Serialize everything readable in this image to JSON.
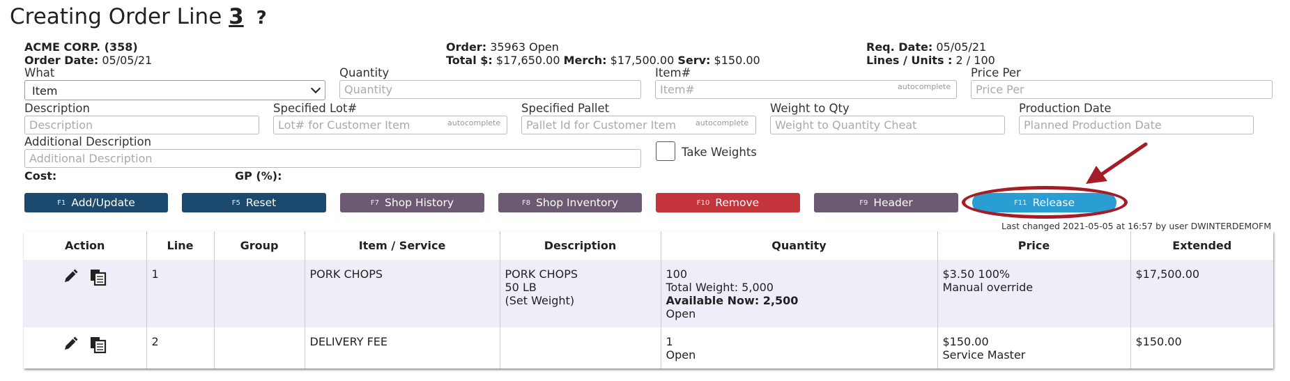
{
  "title": {
    "text": "Creating Order Line",
    "line_number": "3",
    "help": "?"
  },
  "header": {
    "customer": "ACME CORP. (358)",
    "order_date_label": "Order Date:",
    "order_date": "05/05/21",
    "order_label": "Order:",
    "order_value": "35963 Open",
    "total_label": "Total $:",
    "total_value": "$17,650.00",
    "merch_label": "Merch:",
    "merch_value": "$17,500.00",
    "serv_label": "Serv:",
    "serv_value": "$150.00",
    "req_date_label": "Req. Date:",
    "req_date": "05/05/21",
    "lines_units_label": "Lines / Units :",
    "lines_units": "2 / 100"
  },
  "form": {
    "what_label": "What",
    "what_value": "Item",
    "quantity_label": "Quantity",
    "quantity_placeholder": "Quantity",
    "item_label": "Item#",
    "item_placeholder": "Item#",
    "price_label": "Price Per",
    "price_placeholder": "Price Per",
    "description_label": "Description",
    "description_placeholder": "Description",
    "lot_label": "Specified Lot#",
    "lot_placeholder": "Lot# for Customer Item",
    "pallet_label": "Specified Pallet",
    "pallet_placeholder": "Pallet Id for Customer Item",
    "weight_label": "Weight to Qty",
    "weight_placeholder": "Weight to Quantity Cheat",
    "production_label": "Production Date",
    "production_placeholder": "Planned Production Date",
    "additional_label": "Additional Description",
    "additional_placeholder": "Additional Description",
    "take_weights_label": "Take Weights",
    "autocomplete_hint": "autocomplete",
    "cost_label": "Cost:",
    "gp_label": "GP (%):"
  },
  "buttons": [
    {
      "key": "F1",
      "label": "Add/Update"
    },
    {
      "key": "F5",
      "label": "Reset"
    },
    {
      "key": "F7",
      "label": "Shop History"
    },
    {
      "key": "F8",
      "label": "Shop Inventory"
    },
    {
      "key": "F10",
      "label": "Remove"
    },
    {
      "key": "F9",
      "label": "Header"
    },
    {
      "key": "F11",
      "label": "Release"
    }
  ],
  "last_changed": "Last changed 2021-05-05 at 16:57 by user DWINTERDEMOFM",
  "table": {
    "columns": [
      "Action",
      "Line",
      "Group",
      "Item / Service",
      "Description",
      "Quantity",
      "Price",
      "Extended"
    ],
    "rows": [
      {
        "line": "1",
        "group": "",
        "item": "PORK CHOPS",
        "description": [
          "PORK CHOPS",
          "50 LB",
          "(Set Weight)"
        ],
        "quantity": "100",
        "total_weight": "Total Weight: 5,000",
        "available": "Available Now: 2,500",
        "status": "Open",
        "price": "$3.50 100%",
        "price_note": "Manual override",
        "extended": "$17,500.00"
      },
      {
        "line": "2",
        "group": "",
        "item": "DELIVERY FEE",
        "quantity": "1",
        "status": "Open",
        "price": "$150.00",
        "price_note": "Service Master",
        "extended": "$150.00"
      }
    ]
  },
  "colors": {
    "navy_button": "#1c4a6e",
    "mauve_button": "#6b5a72",
    "red_button": "#c3353b",
    "release_button": "#2a9dd2",
    "annotation": "#a51c26"
  },
  "icons": [
    "pencil-icon",
    "copy-icon",
    "chevron-down-icon",
    "help-icon"
  ]
}
